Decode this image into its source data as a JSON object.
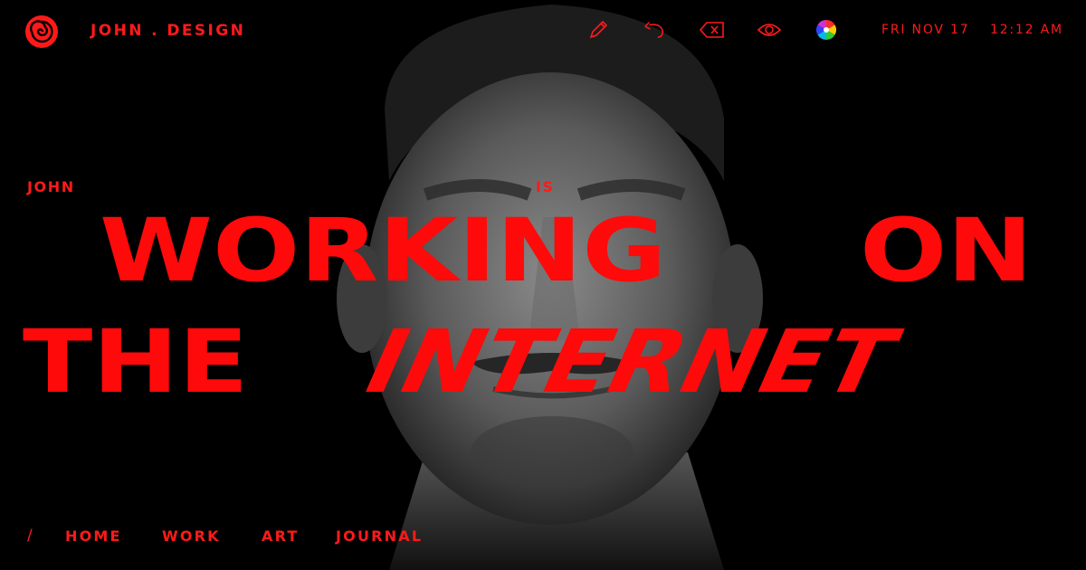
{
  "brand": {
    "name": "JOHN . DESIGN"
  },
  "toolbar": {
    "icons": [
      "pencil-icon",
      "undo-icon",
      "backspace-icon",
      "eye-icon",
      "color-wheel-icon"
    ]
  },
  "clock": {
    "date": "FRI NOV 17",
    "time": "12:12 AM"
  },
  "headline": {
    "subject": "JOHN",
    "verb": "IS",
    "line1_word1": "WORKING",
    "line1_word2": "ON",
    "line2_word1": "THE",
    "line2_word2": "INTERNET"
  },
  "nav": {
    "separator": "/",
    "items": [
      {
        "label": "HOME"
      },
      {
        "label": "WORK"
      },
      {
        "label": "ART"
      },
      {
        "label": "JOURNAL"
      }
    ]
  },
  "colors": {
    "accent": "#ff1a1a",
    "background": "#000000"
  }
}
